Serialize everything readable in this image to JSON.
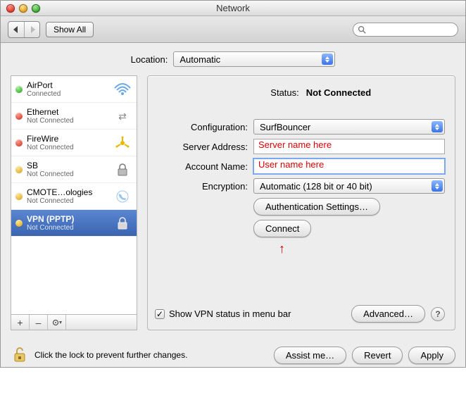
{
  "window": {
    "title": "Network"
  },
  "toolbar": {
    "show_all": "Show All",
    "search_placeholder": ""
  },
  "location": {
    "label": "Location:",
    "value": "Automatic"
  },
  "services": [
    {
      "name": "AirPort",
      "status": "Connected",
      "dot": "green",
      "icon": "wifi"
    },
    {
      "name": "Ethernet",
      "status": "Not Connected",
      "dot": "red",
      "icon": "ethernet"
    },
    {
      "name": "FireWire",
      "status": "Not Connected",
      "dot": "red",
      "icon": "firewire"
    },
    {
      "name": "SB",
      "status": "Not Connected",
      "dot": "yellow",
      "icon": "lock"
    },
    {
      "name": "CMOTE…ologies",
      "status": "Not Connected",
      "dot": "yellow",
      "icon": "phone"
    },
    {
      "name": "VPN (PPTP)",
      "status": "Not Connected",
      "dot": "yellow",
      "icon": "lock"
    }
  ],
  "status": {
    "label": "Status:",
    "value": "Not Connected"
  },
  "form": {
    "configuration_label": "Configuration:",
    "configuration_value": "SurfBouncer",
    "server_label": "Server Address:",
    "server_value": "Server name here",
    "account_label": "Account Name:",
    "account_value": "User name here",
    "encryption_label": "Encryption:",
    "encryption_value": "Automatic (128 bit or 40 bit)",
    "auth_button": "Authentication Settings…",
    "connect_button": "Connect"
  },
  "options": {
    "show_status_label": "Show VPN status in menu bar",
    "advanced_button": "Advanced…"
  },
  "lock": {
    "text": "Click the lock to prevent further changes."
  },
  "buttons": {
    "assist": "Assist me…",
    "revert": "Revert",
    "apply": "Apply"
  }
}
